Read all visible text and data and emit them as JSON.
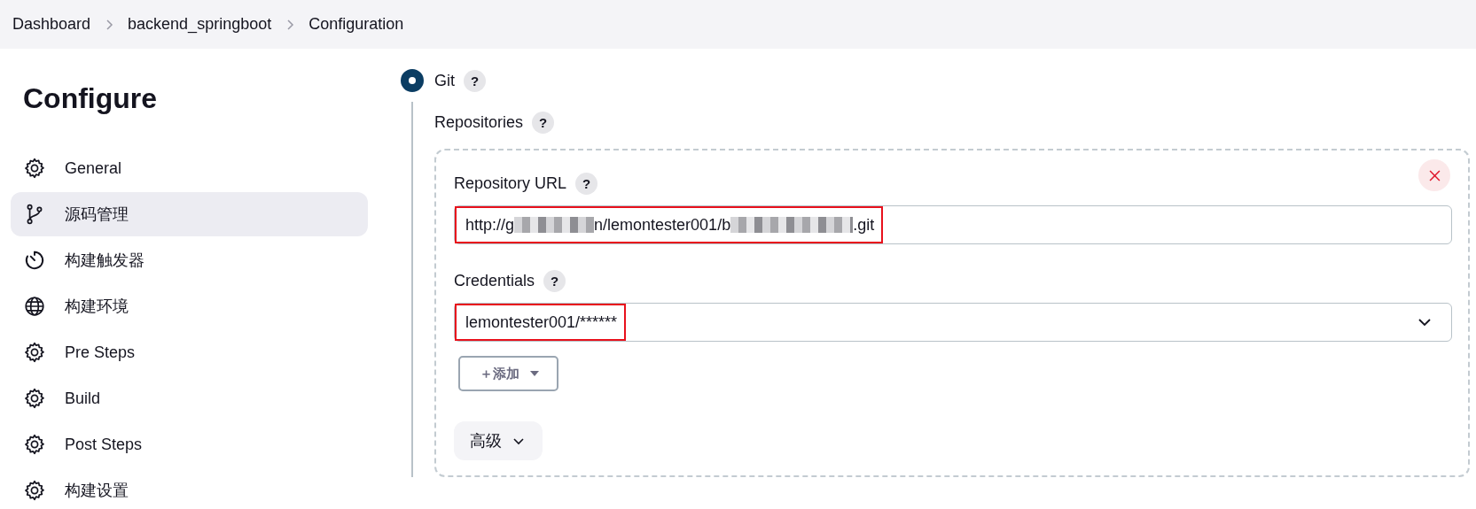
{
  "breadcrumbs": [
    {
      "label": "Dashboard"
    },
    {
      "label": "backend_springboot"
    },
    {
      "label": "Configuration"
    }
  ],
  "sidebar": {
    "title": "Configure",
    "items": [
      {
        "label": "General",
        "kind": "settings",
        "selected": false
      },
      {
        "label": "源码管理",
        "kind": "source",
        "selected": true
      },
      {
        "label": "构建触发器",
        "kind": "trigger",
        "selected": false
      },
      {
        "label": "构建环境",
        "kind": "environment",
        "selected": false
      },
      {
        "label": "Pre Steps",
        "kind": "settings",
        "selected": false
      },
      {
        "label": "Build",
        "kind": "settings",
        "selected": false
      },
      {
        "label": "Post Steps",
        "kind": "settings",
        "selected": false
      },
      {
        "label": "构建设置",
        "kind": "settings",
        "selected": false
      }
    ]
  },
  "scm": {
    "option": {
      "label": "Git",
      "help": "?",
      "selected": true
    },
    "repositories": {
      "label": "Repositories",
      "help": "?",
      "repository_url": {
        "label": "Repository URL",
        "help": "?",
        "highlighted": true,
        "segments": [
          {
            "kind": "text",
            "text": "http://g"
          },
          {
            "kind": "redacted"
          },
          {
            "kind": "text",
            "text": "n/lemontester001/b"
          },
          {
            "kind": "redacted"
          },
          {
            "kind": "text",
            "text": ".git"
          }
        ]
      },
      "credentials": {
        "label": "Credentials",
        "help": "?",
        "value": "lemontester001/******",
        "highlighted": true
      },
      "add_button": {
        "label": "＋添加"
      },
      "advanced_button": {
        "label": "高级"
      }
    }
  }
}
